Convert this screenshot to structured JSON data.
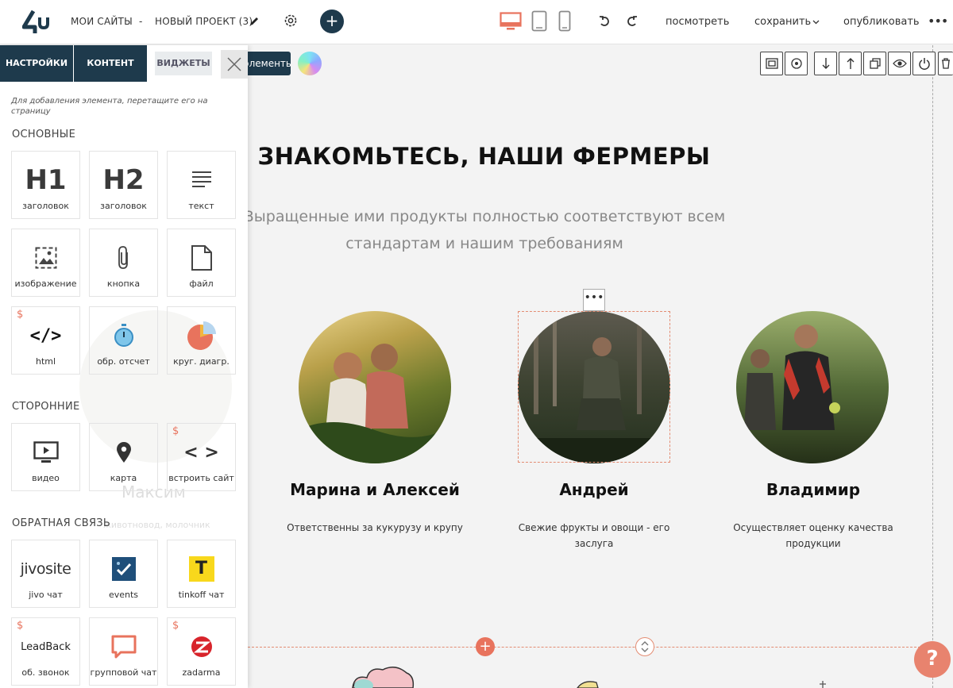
{
  "topbar": {
    "my_sites": "МОИ САЙТЫ",
    "separator": "-",
    "project_name": "НОВЫЙ ПРОЕКТ (3)",
    "preview": "посмотреть",
    "save": "сохранить",
    "publish": "опубликовать",
    "more": "•••"
  },
  "panel": {
    "tabs": [
      "НАСТРОЙКИ",
      "КОНТЕНТ",
      "ВИДЖЕТЫ"
    ],
    "hint": "Для добавления элемента, перетащите его на страницу",
    "sections": {
      "basic": "ОСНОВНЫЕ",
      "third_party": "СТОРОННИЕ",
      "feedback": "ОБРАТНАЯ СВЯЗЬ"
    },
    "tiles": {
      "h1": {
        "icon_text": "H1",
        "label": "заголовок"
      },
      "h2": {
        "icon_text": "H2",
        "label": "заголовок"
      },
      "text": {
        "label": "текст"
      },
      "image": {
        "label": "изображение"
      },
      "button": {
        "label": "кнопка"
      },
      "file": {
        "label": "файл"
      },
      "html": {
        "icon_text": "</>",
        "label": "html"
      },
      "countdown": {
        "label": "обр. отсчет"
      },
      "pie": {
        "label": "круг. диагр."
      },
      "video": {
        "label": "видео"
      },
      "map": {
        "label": "карта"
      },
      "embed": {
        "icon_text": "< >",
        "label": "встроить сайт"
      },
      "jivo": {
        "icon_text": "jivosite",
        "label": "jivo чат"
      },
      "events": {
        "label": "events"
      },
      "tinkoff": {
        "icon_text": "T",
        "label": "tinkoff чат"
      },
      "leadback": {
        "icon_text": "LeadBack",
        "label": "об. звонок"
      },
      "group_chat": {
        "label": "групповой чат"
      },
      "zadarma": {
        "label": "zadarma"
      }
    },
    "dollar": "$"
  },
  "canvas": {
    "elements_button": "элементы",
    "title": "ЗНАКОМЬТЕСЬ, НАШИ ФЕРМЕРЫ",
    "subtitle_line1": "Выращенные ими продукты полностью соответствуют всем",
    "subtitle_line2": "стандартам и нашим требованиям",
    "farmers": [
      {
        "name": "Марина и Алексей",
        "desc": "Ответственны за кукурузу и крупу"
      },
      {
        "name": "Андрей",
        "desc": "Свежие фрукты и овощи - его заслуга"
      },
      {
        "name": "Владимир",
        "desc": "Осуществляет оценку качества продукции"
      }
    ],
    "ghost_name": "Максим",
    "ghost_desc": "животновод, молочник",
    "help": "?"
  },
  "colors": {
    "accent": "#e8735d",
    "navy": "#1e3a4c"
  }
}
